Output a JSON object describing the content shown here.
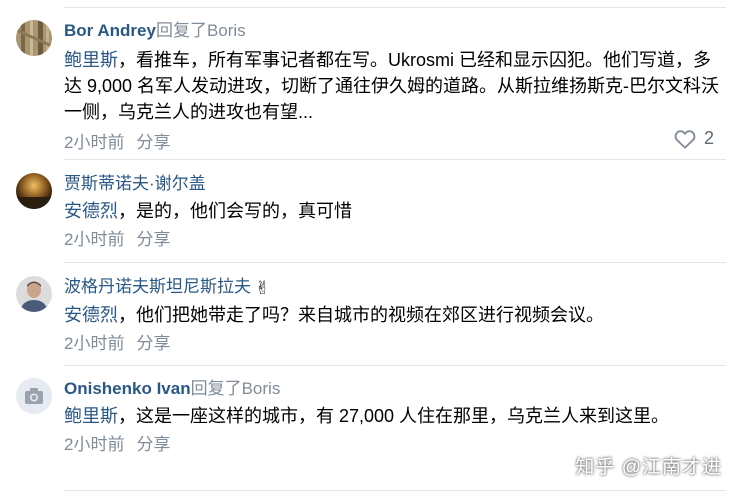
{
  "comments": [
    {
      "author": "Bor Andrey",
      "reply_word": "回复了",
      "reply_to": "Boris",
      "mention": "鲍里斯",
      "text": "，看推车，所有军事记者都在写。Ukrosmi 已经和显示囚犯。他们写道，多达 9,000 名军人发动进攻，切断了通往伊久姆的道路。从斯拉维扬斯克-巴尔文科沃一侧，乌克兰人的进攻也有望...",
      "time": "2小时前",
      "share": "分享",
      "likes": "2"
    },
    {
      "author": "贾斯蒂诺夫·谢尔盖",
      "mention": "安德烈",
      "text": "，是的，他们会写的，真可惜",
      "time": "2小时前",
      "share": "分享"
    },
    {
      "author": "波格丹诺夫斯坦尼斯拉夫",
      "emoji": "✌",
      "mention": "安德烈",
      "text": "，他们把她带走了吗？来自城市的视频在郊区进行视频会议。",
      "time": "2小时前",
      "share": "分享"
    },
    {
      "author": "Onishenko Ivan",
      "reply_word": "回复了",
      "reply_to": "Boris",
      "mention": "鲍里斯",
      "text": "，这是一座这样的城市，有 27,000 人住在那里，乌克兰人来到这里。",
      "time": "2小时前",
      "share": "分享"
    }
  ],
  "watermark": "知乎 @江南才进"
}
